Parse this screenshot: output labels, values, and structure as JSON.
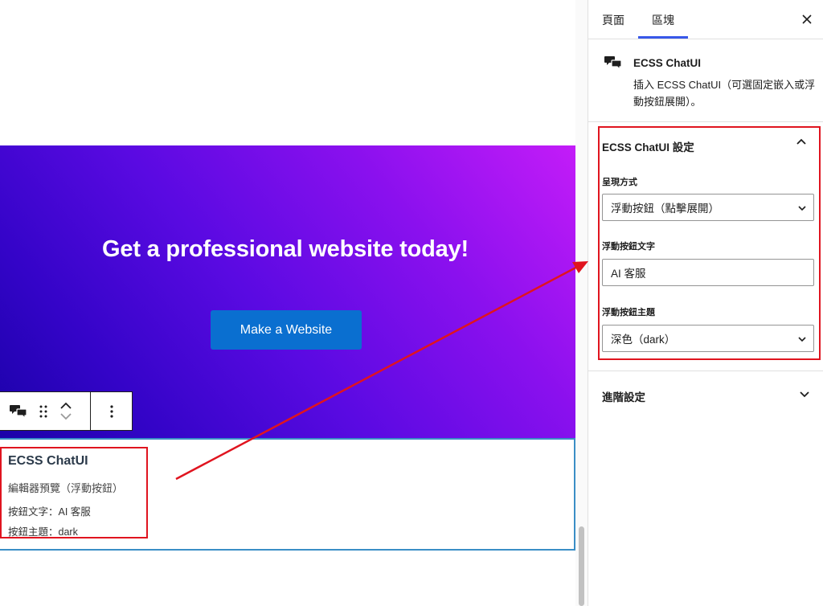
{
  "hero": {
    "heading": "Get a professional website today!",
    "button": "Make a Website"
  },
  "block_preview": {
    "title": "ECSS ChatUI",
    "subtitle": "編輯器預覽（浮動按鈕）",
    "button_text_line": "按鈕文字：AI 客服",
    "button_theme_line": "按鈕主題：dark"
  },
  "sidebar": {
    "tabs": {
      "page": "頁面",
      "block": "區塊"
    },
    "active_tab": "block",
    "block_card": {
      "title": "ECSS ChatUI",
      "description": "插入 ECSS ChatUI（可選固定嵌入或浮動按鈕展開）。"
    },
    "settings_panel": {
      "title": "ECSS ChatUI 設定",
      "display_mode_label": "呈現方式",
      "display_mode_value": "浮動按鈕（點擊展開）",
      "button_text_label": "浮動按鈕文字",
      "button_text_value": "AI 客服",
      "button_theme_label": "浮動按鈕主題",
      "button_theme_value": "深色（dark）"
    },
    "advanced_panel": {
      "title": "進階設定"
    }
  },
  "icons": {
    "block": "chat-bubbles-icon",
    "drag": "drag-handle-icon",
    "move_up": "chevron-up-icon",
    "move_down": "chevron-down-icon",
    "options": "more-vertical-icon",
    "close": "close-icon"
  },
  "colors": {
    "accent": "#3858e9",
    "highlight": "#e0141f",
    "hero_button": "#0a6fd0",
    "block_selection": "#3a8ec6"
  }
}
